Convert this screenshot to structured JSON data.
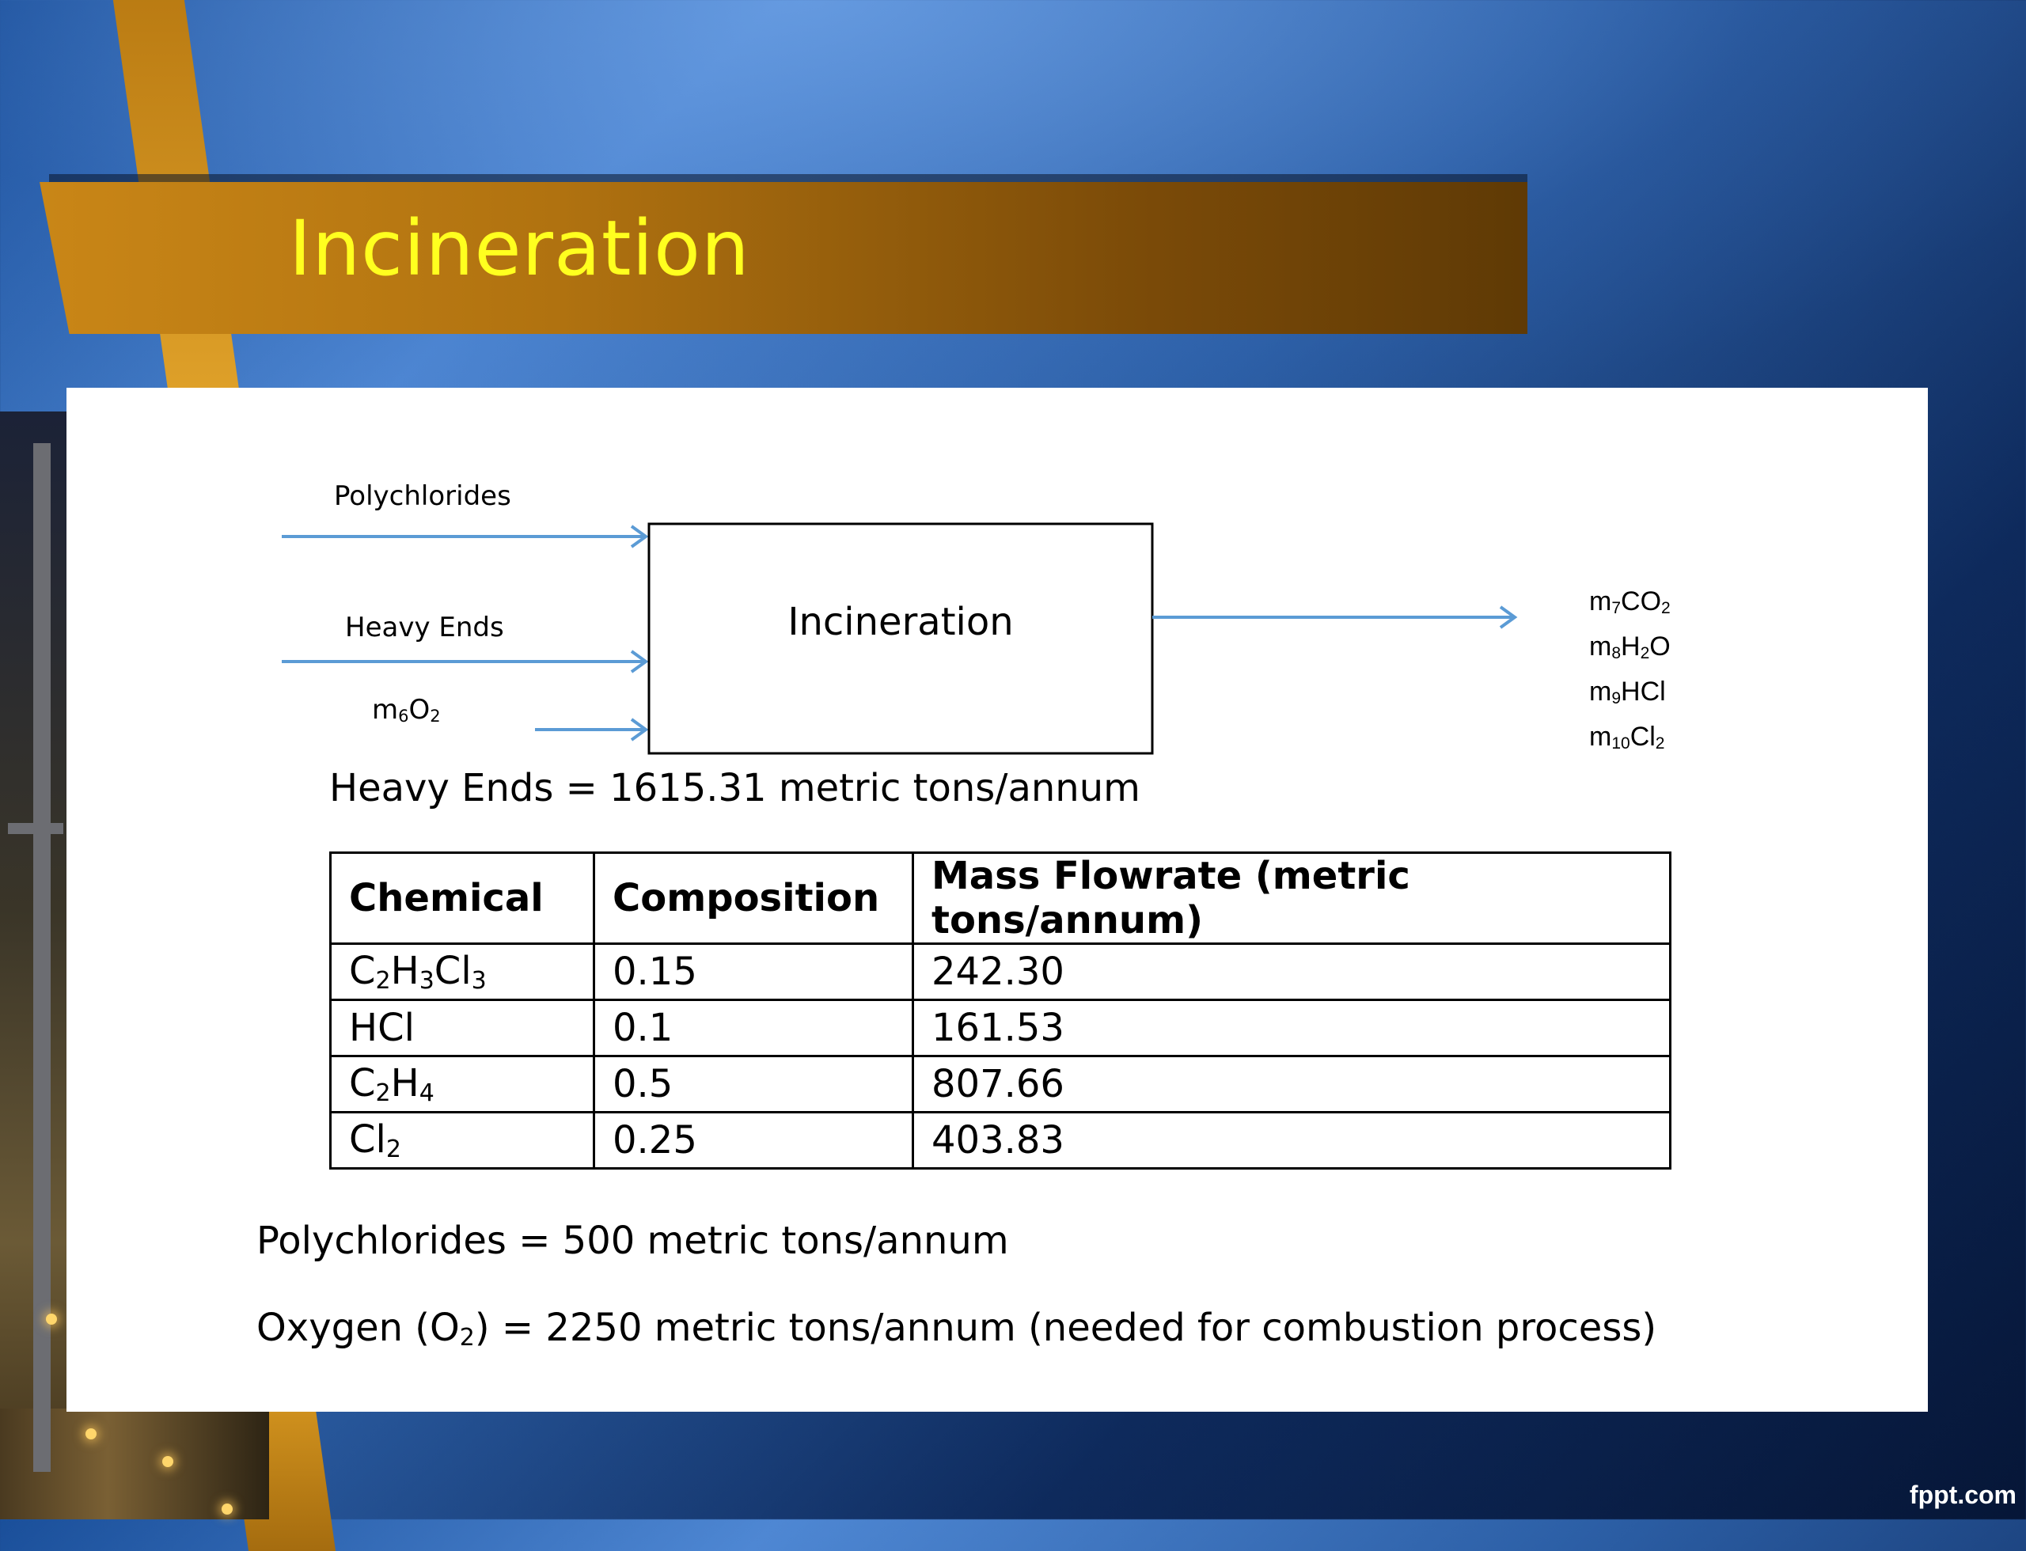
{
  "slide": {
    "title": "Incineration",
    "watermark": "fppt.com"
  },
  "diagram": {
    "inputs": [
      "Polychlorides",
      "Heavy Ends"
    ],
    "oxygen_input": {
      "prefix": "m",
      "index": "6",
      "species": "O",
      "species_sub": "2"
    },
    "process_label": "Incineration",
    "products": [
      {
        "prefix": "m",
        "index": "7",
        "parts": [
          "CO",
          "2",
          ""
        ]
      },
      {
        "prefix": "m",
        "index": "8",
        "parts": [
          "H",
          "2",
          "O"
        ]
      },
      {
        "prefix": "m",
        "index": "9",
        "parts": [
          "HCl",
          "",
          ""
        ]
      },
      {
        "prefix": "m",
        "index": "10",
        "parts": [
          "Cl",
          "2",
          ""
        ]
      }
    ]
  },
  "heavy_ends_text": "Heavy Ends = 1615.31 metric tons/annum",
  "table": {
    "headers": [
      "Chemical",
      "Composition",
      "Mass Flowrate (metric tons/annum)"
    ],
    "rows": [
      {
        "chemical": [
          "C",
          "2",
          "H",
          "3",
          "Cl",
          "3"
        ],
        "composition": "0.15",
        "flow": "242.30"
      },
      {
        "chemical": [
          "HCl"
        ],
        "composition": "0.1",
        "flow": "161.53"
      },
      {
        "chemical": [
          "C",
          "2",
          "H",
          "4"
        ],
        "composition": "0.5",
        "flow": "807.66"
      },
      {
        "chemical": [
          "Cl",
          "2"
        ],
        "composition": "0.25",
        "flow": "403.83"
      }
    ]
  },
  "polychlorides_text": "Polychlorides = 500 metric tons/annum",
  "oxygen_text": {
    "before": "Oxygen (O",
    "sub": "2",
    "after": ") = 2250 metric tons/annum (needed for combustion process)"
  },
  "colors": {
    "arrow": "#5b9bd5",
    "title_text": "#ffff1f",
    "banner": "#b07210"
  }
}
